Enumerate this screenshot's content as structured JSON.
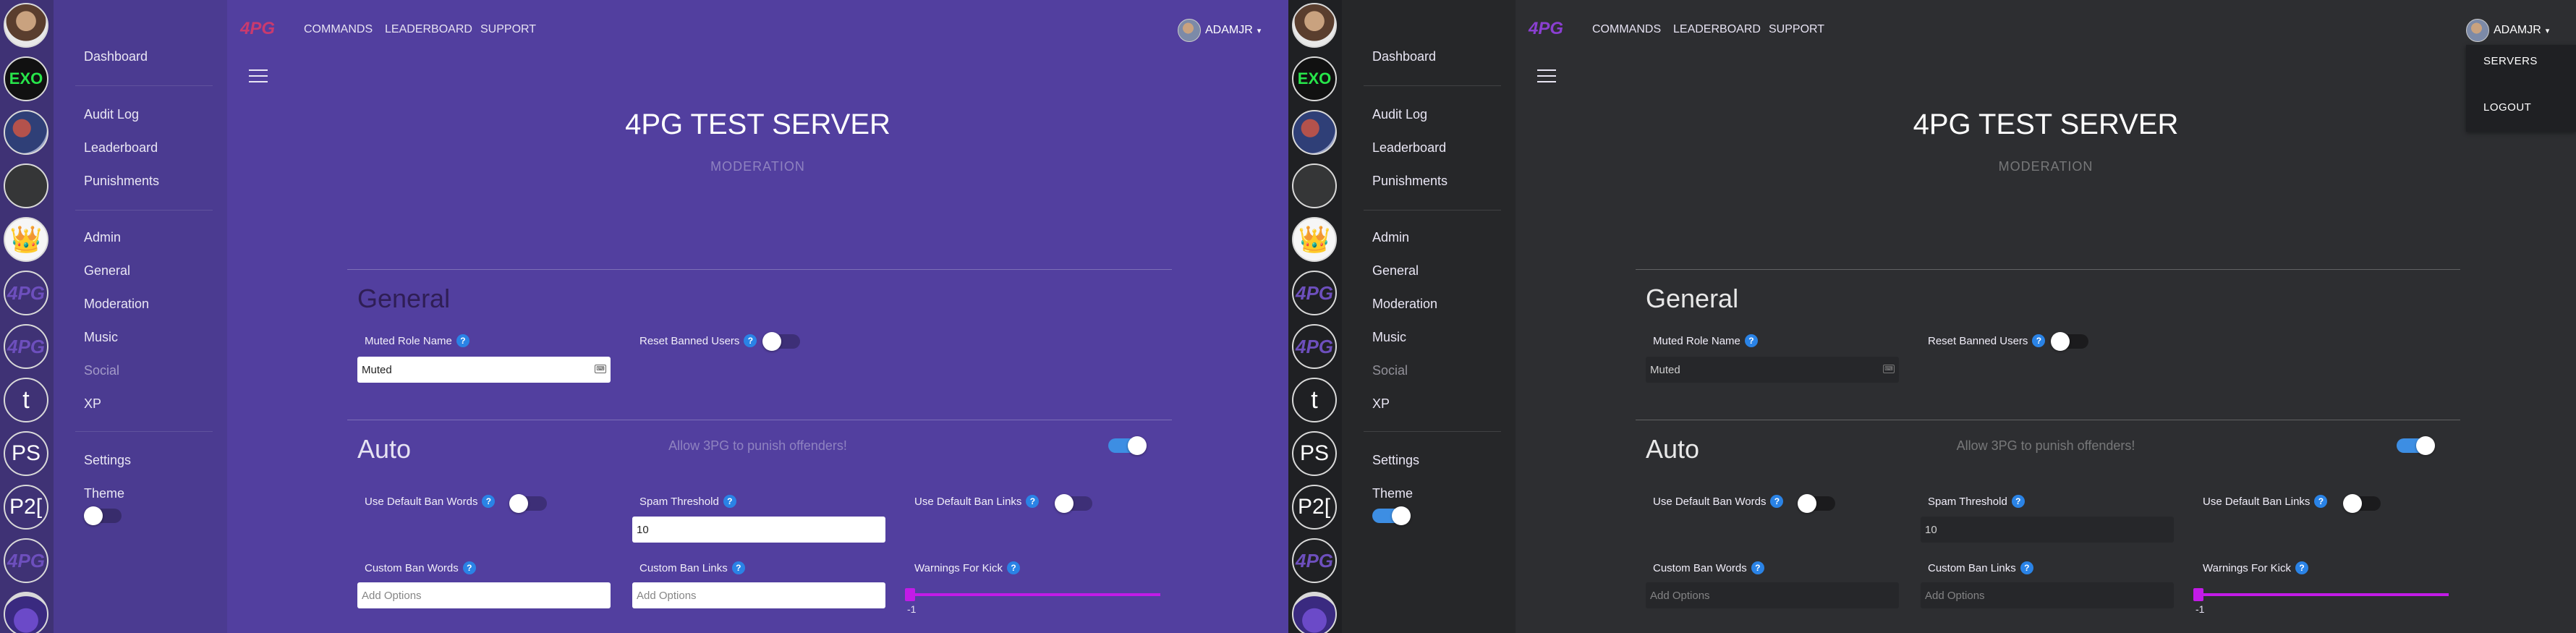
{
  "nav": {
    "dashboard": "Dashboard",
    "audit_log": "Audit Log",
    "leaderboard": "Leaderboard",
    "punishments": "Punishments",
    "admin": "Admin",
    "general": "General",
    "moderation": "Moderation",
    "music": "Music",
    "social": "Social",
    "xp": "XP",
    "settings": "Settings",
    "theme": "Theme"
  },
  "servers": {
    "exo": "EXO",
    "crown": "👑",
    "fourpg": "4PG",
    "t": "t",
    "ps": "PS",
    "p2": "P2["
  },
  "topbar": {
    "logo": "4PG",
    "commands": "COMMANDS",
    "leaderboard": "LEADERBOARD",
    "support": "SUPPORT",
    "username": "ADAMJR",
    "caret": "▾"
  },
  "dropdown": {
    "servers": "SERVERS",
    "logout": "LOGOUT"
  },
  "page": {
    "server_name": "4PG TEST SERVER",
    "module": "MODERATION"
  },
  "general": {
    "title": "General",
    "muted_role_label": "Muted Role Name",
    "muted_role_value": "Muted",
    "reset_banned_label": "Reset Banned Users"
  },
  "auto": {
    "title": "Auto",
    "description": "Allow 3PG to punish offenders!",
    "enabled": true,
    "use_default_ban_words_label": "Use Default Ban Words",
    "spam_threshold_label": "Spam Threshold",
    "spam_threshold_value": "10",
    "use_default_ban_links_label": "Use Default Ban Links",
    "custom_ban_words_label": "Custom Ban Words",
    "custom_ban_words_placeholder": "Add Options",
    "custom_ban_links_label": "Custom Ban Links",
    "custom_ban_links_placeholder": "Add Options",
    "warnings_for_kick_label": "Warnings For Kick",
    "warnings_for_kick_value": "-1"
  },
  "info_glyph": "?",
  "keyboard_glyph": "⌨",
  "themes": {
    "left": {
      "name": "purple",
      "theme_toggle": false
    },
    "right": {
      "name": "dark",
      "theme_toggle": true
    }
  },
  "colors": {
    "accent": "#3d8ee3",
    "slider": "#c21be7",
    "info": "#2a83e6"
  }
}
